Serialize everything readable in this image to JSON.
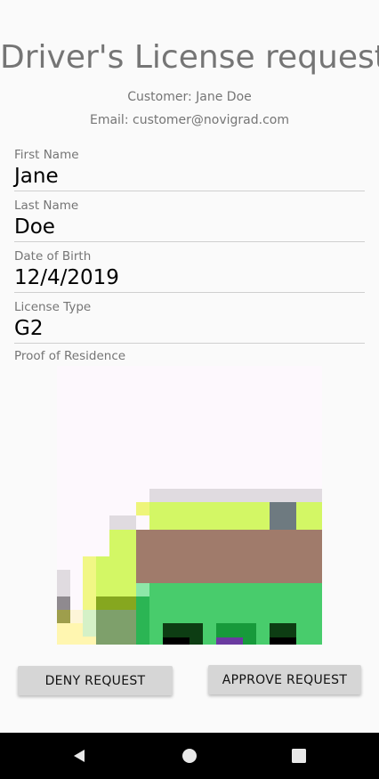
{
  "header": {
    "title": "Driver's License request",
    "customer": "Customer: Jane Doe",
    "email": "Email: customer@novigrad.com"
  },
  "form": {
    "first_name": {
      "label": "First Name",
      "value": "Jane"
    },
    "last_name": {
      "label": "Last Name",
      "value": "Doe"
    },
    "dob": {
      "label": "Date of Birth",
      "value": "12/4/2019"
    },
    "license_type": {
      "label": "License Type",
      "value": "G2"
    },
    "proof": {
      "label": "Proof of Residence"
    }
  },
  "actions": {
    "deny_label": "DENY REQUEST",
    "approve_label": "APPROVE REQUEST"
  },
  "navbar": {
    "icons": [
      "back-icon",
      "home-icon",
      "recents-icon"
    ]
  },
  "colors": {
    "background": "#fafafa",
    "text_secondary": "#757575",
    "button": "#d6d6d6",
    "navbar": "#000000"
  }
}
